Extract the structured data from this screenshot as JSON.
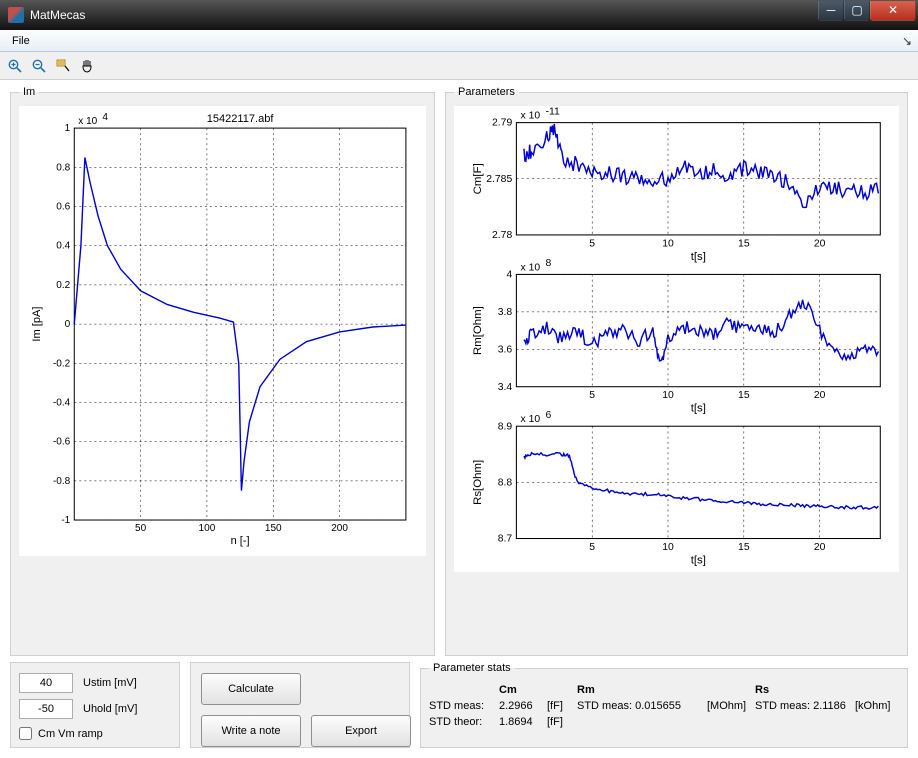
{
  "window": {
    "title": "MatMecas"
  },
  "menu": {
    "file": "File"
  },
  "toolbar_icons": {
    "zoom_in": "zoom-in-icon",
    "zoom_out": "zoom-out-icon",
    "data_cursor": "data-cursor-icon",
    "pan": "pan-icon"
  },
  "panels": {
    "im": "Im",
    "parameters": "Parameters",
    "stats": "Parameter stats"
  },
  "inputs": {
    "ustim_value": "40",
    "ustim_label": "Ustim [mV]",
    "uhold_value": "-50",
    "uhold_label": "Uhold [mV]",
    "cm_ramp_label": "Cm Vm ramp"
  },
  "buttons": {
    "calculate": "Calculate",
    "write_note": "Write a note",
    "export": "Export"
  },
  "stats": {
    "cm_hdr": "Cm",
    "rm_hdr": "Rm",
    "rs_hdr": "Rs",
    "row1_label": "STD meas:",
    "cm_meas": "2.2966",
    "cm_unit": "[fF]",
    "rm_label": "STD meas:",
    "rm_meas": "0.015655",
    "rm_unit": "[MOhm]",
    "rs_label": "STD meas:",
    "rs_meas": "2.1186",
    "rs_unit": "[kOhm]",
    "row2_label": "STD theor:",
    "cm_theor": "1.8694",
    "cm_theor_unit": "[fF]"
  },
  "chart_data": [
    {
      "id": "im",
      "type": "line",
      "title": "15422117.abf",
      "xlabel": "n [-]",
      "ylabel": "Im [pA]",
      "y_multiplier_text": "x 10",
      "y_multiplier_exp": "4",
      "xlim": [
        0,
        250
      ],
      "xticks": [
        50,
        100,
        150,
        200
      ],
      "ylim": [
        -1,
        1
      ],
      "yticks": [
        -1,
        -0.8,
        -0.6,
        -0.4,
        -0.2,
        0,
        0.2,
        0.4,
        0.6,
        0.8,
        1
      ],
      "series": [
        {
          "name": "Im",
          "x": [
            0,
            5,
            8,
            12,
            18,
            25,
            35,
            50,
            70,
            90,
            110,
            120,
            124,
            126,
            128,
            132,
            140,
            155,
            175,
            200,
            225,
            250
          ],
          "y": [
            0,
            0.4,
            0.85,
            0.72,
            0.55,
            0.4,
            0.28,
            0.17,
            0.1,
            0.06,
            0.03,
            0.01,
            -0.2,
            -0.85,
            -0.7,
            -0.5,
            -0.32,
            -0.18,
            -0.09,
            -0.04,
            -0.015,
            -0.005
          ]
        }
      ]
    },
    {
      "id": "cm",
      "type": "line",
      "ylabel": "Cm[F]",
      "y_multiplier_text": "x 10",
      "y_multiplier_exp": "-11",
      "xlim": [
        0,
        24
      ],
      "xticks": [
        5,
        10,
        15,
        20
      ],
      "ylim": [
        2.78,
        2.79
      ],
      "yticks": [
        2.78,
        2.785,
        2.79
      ],
      "xlabel": "t[s]",
      "series": [
        {
          "name": "Cm",
          "x": [
            0.5,
            1,
            2,
            2.5,
            3,
            4,
            5,
            6,
            7,
            8,
            9,
            10,
            11,
            12,
            13,
            14,
            15,
            16,
            17,
            18,
            19,
            20,
            21,
            22,
            23,
            24
          ],
          "y": [
            2.787,
            2.7875,
            2.7885,
            2.7895,
            2.787,
            2.7862,
            2.7858,
            2.7855,
            2.7852,
            2.785,
            2.7848,
            2.785,
            2.7865,
            2.7855,
            2.7858,
            2.785,
            2.786,
            2.7855,
            2.785,
            2.7848,
            2.783,
            2.7845,
            2.7842,
            2.784,
            2.7838,
            2.784
          ]
        }
      ]
    },
    {
      "id": "rm",
      "type": "line",
      "ylabel": "Rm[Ohm]",
      "y_multiplier_text": "x 10",
      "y_multiplier_exp": "8",
      "xlim": [
        0,
        24
      ],
      "xticks": [
        5,
        10,
        15,
        20
      ],
      "ylim": [
        3.4,
        4
      ],
      "yticks": [
        3.4,
        3.6,
        3.8,
        4
      ],
      "xlabel": "t[s]",
      "series": [
        {
          "name": "Rm",
          "x": [
            0.5,
            1,
            2,
            3,
            4,
            5,
            6,
            7,
            8,
            9,
            9.5,
            10,
            11,
            12,
            13,
            14,
            15,
            16,
            17,
            18,
            19,
            20,
            21,
            22,
            23,
            24
          ],
          "y": [
            3.65,
            3.68,
            3.72,
            3.65,
            3.7,
            3.62,
            3.68,
            3.71,
            3.64,
            3.7,
            3.52,
            3.66,
            3.72,
            3.7,
            3.68,
            3.74,
            3.7,
            3.72,
            3.68,
            3.78,
            3.85,
            3.7,
            3.6,
            3.55,
            3.62,
            3.58
          ]
        }
      ]
    },
    {
      "id": "rs",
      "type": "line",
      "ylabel": "Rs[Ohm]",
      "y_multiplier_text": "x 10",
      "y_multiplier_exp": "6",
      "xlim": [
        0,
        24
      ],
      "xticks": [
        5,
        10,
        15,
        20
      ],
      "ylim": [
        8.7,
        8.9
      ],
      "yticks": [
        8.7,
        8.8,
        8.9
      ],
      "xlabel": "t[s]",
      "series": [
        {
          "name": "Rs",
          "x": [
            0.5,
            1,
            2,
            3,
            3.5,
            4,
            5,
            6,
            7,
            8,
            9,
            10,
            11,
            12,
            13,
            14,
            15,
            16,
            17,
            18,
            19,
            20,
            21,
            22,
            23,
            24
          ],
          "y": [
            8.845,
            8.85,
            8.85,
            8.85,
            8.848,
            8.8,
            8.79,
            8.785,
            8.78,
            8.778,
            8.78,
            8.775,
            8.772,
            8.77,
            8.768,
            8.765,
            8.763,
            8.762,
            8.76,
            8.76,
            8.758,
            8.758,
            8.756,
            8.756,
            8.755,
            8.755
          ]
        }
      ]
    }
  ]
}
